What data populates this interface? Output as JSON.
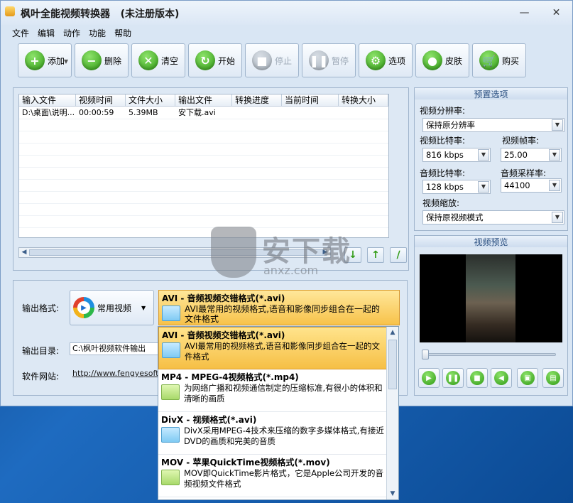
{
  "window": {
    "title": "枫叶全能视频转换器   (未注册版本)",
    "controls": {
      "minimize": "—",
      "close": "✕"
    }
  },
  "menu": [
    "文件",
    "编辑",
    "动作",
    "功能",
    "帮助"
  ],
  "toolbar": {
    "add": "添加",
    "delete": "删除",
    "clear": "清空",
    "start": "开始",
    "stop": "停止",
    "pause": "暂停",
    "options": "选项",
    "skin": "皮肤",
    "buy": "购买"
  },
  "file_table": {
    "headers": [
      "输入文件",
      "视频时间",
      "文件大小",
      "输出文件",
      "转换进度",
      "当前时间",
      "转换大小"
    ],
    "rows": [
      [
        "D:\\桌面\\说明...",
        "00:00:59",
        "5.39MB",
        "安下载.avi",
        "",
        "",
        ""
      ]
    ]
  },
  "output": {
    "format_label": "输出格式:",
    "category_button": "常用视频",
    "selected_format_title": "AVI - 音频视频交错格式(*.avi)",
    "selected_format_desc": "AVI最常用的视频格式,语音和影像同步组合在一起的文件格式",
    "dir_label": "输出目录:",
    "dir_value": "C:\\枫叶视频软件输出",
    "site_label": "软件网站:",
    "site_value": "http://www.fengyesoft.c"
  },
  "format_options": [
    {
      "title": "AVI - 音频视频交错格式(*.avi)",
      "desc": "AVI最常用的视频格式,语音和影像同步组合在一起的文件格式",
      "icon": "folder-blue-icon",
      "selected": true
    },
    {
      "title": "MP4 - MPEG-4视频格式(*.mp4)",
      "desc": "为网络广播和视频通信制定的压缩标准,有很小的体积和清晰的画质",
      "icon": "folder-green-icon",
      "selected": false
    },
    {
      "title": "DivX - 视频格式(*.avi)",
      "desc": "DivX采用MPEG-4技术来压缩的数字多媒体格式,有接近DVD的画质和完美的音质",
      "icon": "folder-blue-icon",
      "selected": false
    },
    {
      "title": "MOV - 苹果QuickTime视频格式(*.mov)",
      "desc": "MOV即QuickTime影片格式，它是Apple公司开发的音频视频文件格式",
      "icon": "folder-green-icon",
      "selected": false
    }
  ],
  "preset": {
    "title": "预置选项",
    "resolution_label": "视频分辨率:",
    "resolution_value": "保持原分辨率",
    "vbitrate_label": "视频比特率:",
    "vbitrate_value": "816 kbps",
    "framerate_label": "视频帧率:",
    "framerate_value": "25.00",
    "abitrate_label": "音频比特率:",
    "abitrate_value": "128 kbps",
    "samplerate_label": "音频采样率:",
    "samplerate_value": "44100",
    "scale_label": "视频缩放:",
    "scale_value": "保持原视频模式"
  },
  "preview": {
    "title": "视频预览"
  },
  "watermark": {
    "big": "安下载",
    "small": "anxz.com"
  },
  "colors": {
    "window_bg": "#d9e6f4",
    "accent_green": "#2f9a13",
    "selected_orange": "#f7c24a"
  }
}
